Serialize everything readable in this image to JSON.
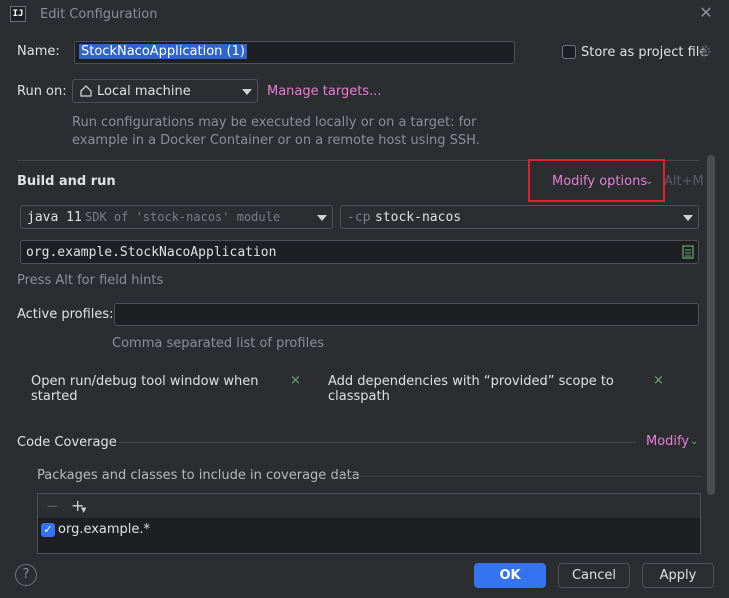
{
  "window": {
    "app_icon_text": "IJ",
    "title": "Edit Configuration",
    "close_glyph": "✕"
  },
  "name_field": {
    "label": "Name:",
    "value": "StockNacoApplication (1)"
  },
  "store_project": {
    "label": "Store as project file",
    "icon": "gear-icon",
    "checked": false
  },
  "run_on": {
    "label": "Run on:",
    "selected": "Local machine",
    "icon": "home-icon",
    "manage_link": "Manage targets...",
    "hint_line1": "Run configurations may be executed locally or on a target: for",
    "hint_line2": "example in a Docker Container or on a remote host using SSH."
  },
  "build_run": {
    "heading": "Build and run",
    "modify_options": "Modify options",
    "modify_shortcut": "Alt+M",
    "jdk_main": "java 11",
    "jdk_sub": "SDK of 'stock-nacos' module",
    "cp_prefix": "-cp",
    "cp_value": "stock-nacos",
    "main_class": "org.example.StockNacoApplication",
    "field_hint": "Press Alt for field hints"
  },
  "profiles": {
    "label": "Active profiles:",
    "value": "",
    "hint": "Comma separated list of profiles"
  },
  "chips": [
    {
      "label": "Open run/debug tool window when started",
      "close": "×"
    },
    {
      "label": "Add dependencies with “provided” scope to classpath",
      "close": "×"
    }
  ],
  "coverage": {
    "heading": "Code Coverage",
    "modify": "Modify",
    "packages_label": "Packages and classes to include in coverage data",
    "remove_glyph": "−",
    "add_glyph": "+",
    "items": [
      {
        "pattern": "org.example.*",
        "checked": true
      }
    ]
  },
  "footer": {
    "help": "?",
    "ok": "OK",
    "cancel": "Cancel",
    "apply": "Apply"
  },
  "colors": {
    "accent": "#3574f0",
    "link": "#e77fd6",
    "highlight_box": "#e0202a",
    "background": "#2b2d30"
  }
}
